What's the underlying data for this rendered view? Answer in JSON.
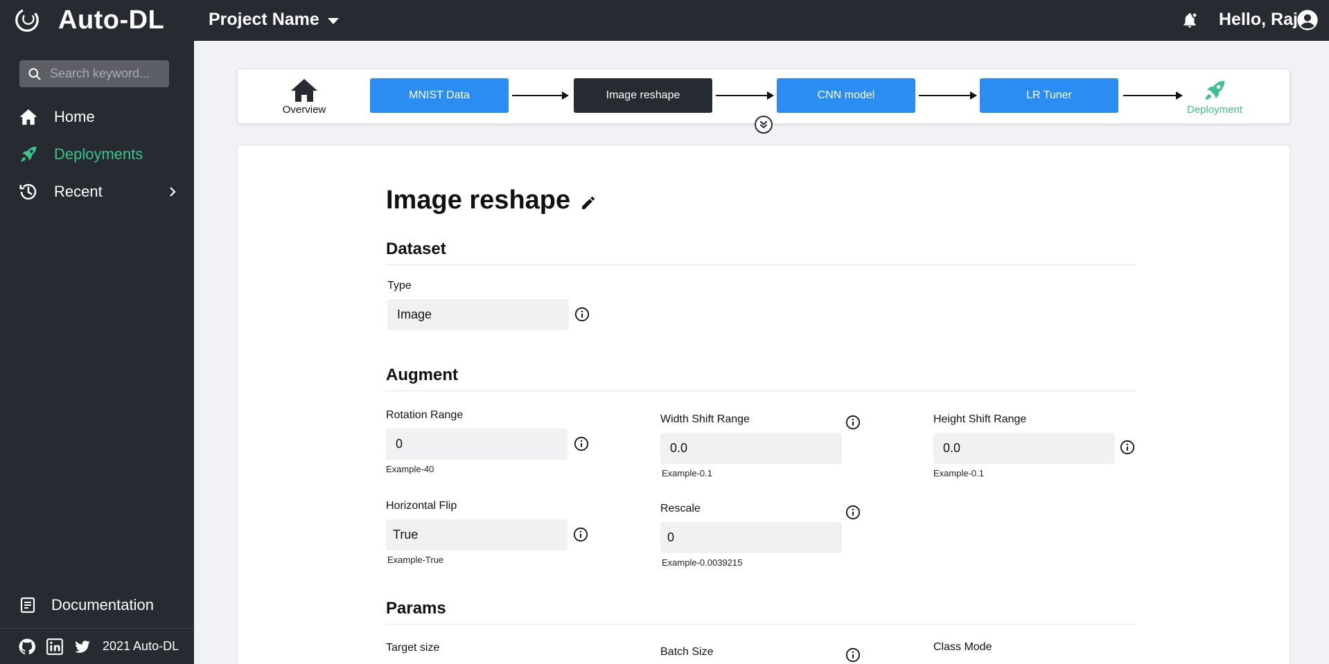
{
  "header": {
    "app_name": "Auto-DL",
    "project_name": "Project Name",
    "greeting": "Hello, Raj"
  },
  "sidebar": {
    "search_placeholder": "Search keyword...",
    "items": [
      {
        "label": "Home"
      },
      {
        "label": "Deployments"
      },
      {
        "label": "Recent"
      }
    ],
    "documentation": "Documentation",
    "copyright": "2021 Auto-DL"
  },
  "pipeline": {
    "overview_label": "Overview",
    "steps": [
      {
        "label": "MNIST Data"
      },
      {
        "label": "Image reshape"
      },
      {
        "label": "CNN model"
      },
      {
        "label": "LR Tuner"
      }
    ],
    "deployment_label": "Deployment"
  },
  "form": {
    "title": "Image reshape",
    "dataset": {
      "heading": "Dataset",
      "type_label": "Type",
      "type_value": "Image"
    },
    "augment": {
      "heading": "Augment",
      "rotation_range": {
        "label": "Rotation Range",
        "value": "0",
        "hint": "Example-40"
      },
      "width_shift_range": {
        "label": "Width Shift Range",
        "value": "0.0",
        "hint": "Example-0.1"
      },
      "height_shift_range": {
        "label": "Height Shift Range",
        "value": "0.0",
        "hint": "Example-0.1"
      },
      "horizontal_flip": {
        "label": "Horizontal Flip",
        "value": "True",
        "hint": "Example-True"
      },
      "rescale": {
        "label": "Rescale",
        "value": "0",
        "hint": "Example-0.0039215"
      }
    },
    "params": {
      "heading": "Params",
      "target_size_label": "Target size",
      "batch_size_label": "Batch Size",
      "class_mode_label": "Class Mode"
    }
  },
  "colors": {
    "dark": "#262a31",
    "accent_green": "#3ec28a",
    "accent_blue": "#2b8df2"
  }
}
